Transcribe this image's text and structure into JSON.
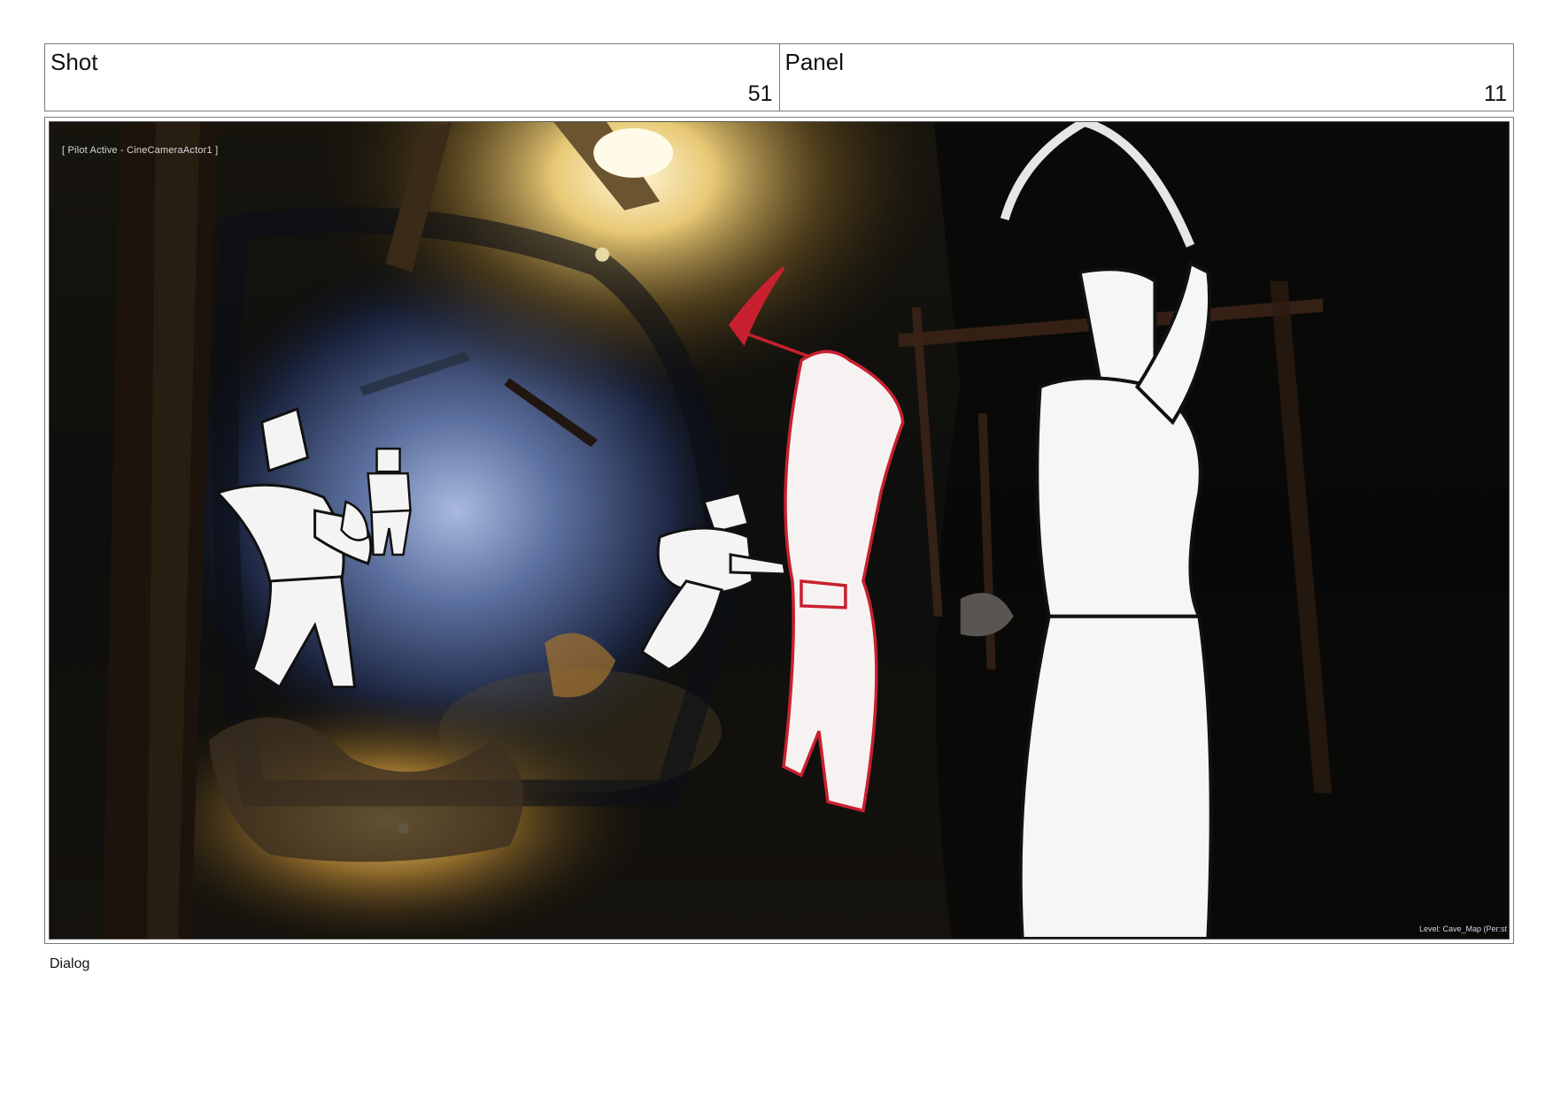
{
  "header": {
    "shot_label": "Shot",
    "shot_value": "51",
    "panel_label": "Panel",
    "panel_value": "11"
  },
  "frame": {
    "viewport_overlay": "[ Pilot Active - CineCameraActor1 ]",
    "level_overlay": "Level:  Cave_Map (Per:st"
  },
  "dialog": {
    "label": "Dialog"
  },
  "colors": {
    "border": "#7a7a7a",
    "sketch_white": "#f4f4f4",
    "sketch_red": "#c8202f",
    "cave_dark": "#0b0c0c"
  }
}
